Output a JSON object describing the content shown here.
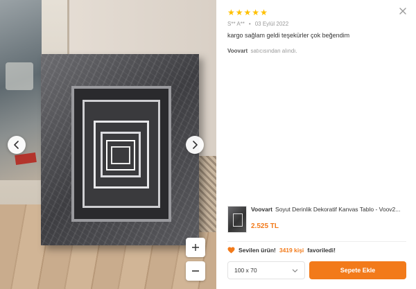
{
  "review": {
    "rating": 5,
    "stars": [
      "★",
      "★",
      "★",
      "★",
      "★"
    ],
    "author": "S** A**",
    "separator": "•",
    "date": "03 Eylül 2022",
    "comment": "kargo sağlam geldi teşekürler çok beğendim",
    "seller_name": "Voovart",
    "seller_suffix": "satıcısından alındı."
  },
  "product": {
    "brand": "Voovart",
    "title": "Soyut Derinlik Dekoratif Kanvas Tablo - Voov2...",
    "price": "2.525 TL"
  },
  "favorite": {
    "prefix": "Sevilen ürün!",
    "count": "3419 kişi",
    "suffix": "favoriledi!"
  },
  "size_select": {
    "value": "100 x 70"
  },
  "add_to_cart": "Sepete Ekle",
  "colors": {
    "accent": "#f27a1a",
    "star": "#ffc000"
  }
}
